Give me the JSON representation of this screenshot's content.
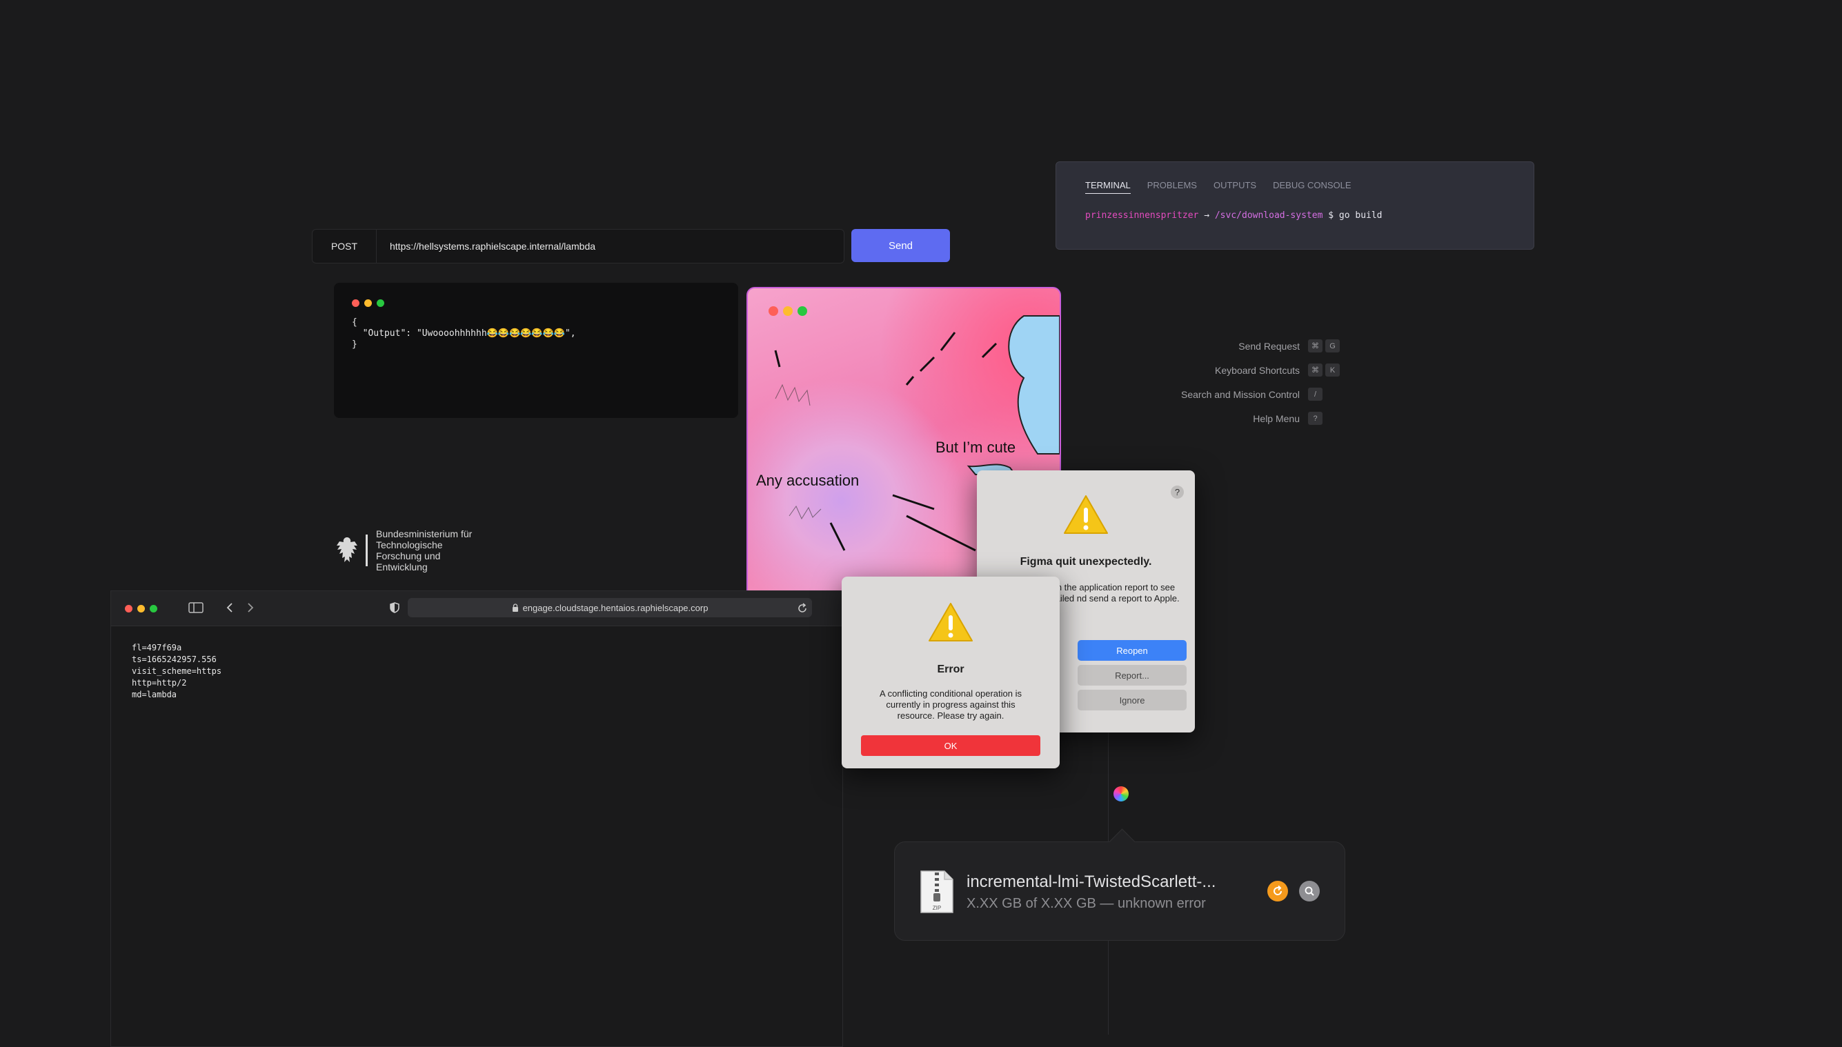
{
  "request": {
    "method": "POST",
    "url": "https://hellsystems.raphielscape.internal/lambda",
    "send_label": "Send"
  },
  "response": {
    "code": "{\n  \"Output\": \"Uwoooohhhhhh😂😂😂😂😂😂😂\",\n}"
  },
  "terminal": {
    "tabs": [
      "TERMINAL",
      "PROBLEMS",
      "OUTPUTS",
      "DEBUG CONSOLE"
    ],
    "active_tab": "TERMINAL",
    "user": "prinzessinnenspritzer",
    "arrow": "→",
    "path": "/svc/download-system",
    "prompt": "$",
    "command": "go build"
  },
  "shortcuts": [
    {
      "label": "Send Request",
      "keys": [
        "⌘",
        "G"
      ]
    },
    {
      "label": "Keyboard Shortcuts",
      "keys": [
        "⌘",
        "K"
      ]
    },
    {
      "label": "Search and Mission Control",
      "keys": [
        "/"
      ]
    },
    {
      "label": "Help Menu",
      "keys": [
        "?"
      ]
    }
  ],
  "meme": {
    "text_left": "Any accusation",
    "text_right": "But I’m cute"
  },
  "logo": {
    "text": "Bundesministerium für Technologische Forschung und Entwicklung"
  },
  "browser": {
    "url": "engage.cloudstage.hentaios.raphielscape.corp",
    "body": "fl=497f69a\nts=1665242957.556\nvisit_scheme=https\nhttp=http/2\nmd=lambda"
  },
  "figma_dialog": {
    "help": "?",
    "title": "Figma quit unexpectedly.",
    "body": "n to open the application report to see more detailed nd send a report to Apple.",
    "reopen": "Reopen",
    "report": "Report...",
    "ignore": "Ignore"
  },
  "error_dialog": {
    "title": "Error",
    "body": "A conflicting conditional operation is currently in progress against this resource. Please try again.",
    "ok": "OK"
  },
  "download": {
    "filename": "incremental-lmi-TwistedScarlett-...",
    "status": "X.XX GB of X.XX GB  — unknown error",
    "file_type": "ZIP"
  },
  "colors": {
    "send": "#5e6bf1",
    "reopen": "#3c82f7",
    "ok": "#f0343a",
    "retry": "#f59a1c",
    "terminal_user": "#e54cc0"
  }
}
